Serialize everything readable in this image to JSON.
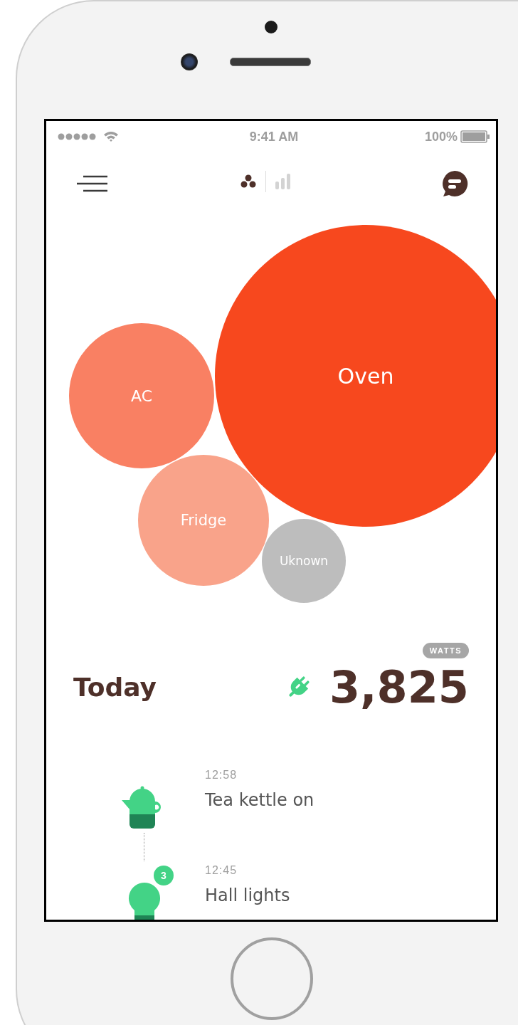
{
  "status_bar": {
    "time": "9:41 AM",
    "battery": "100%"
  },
  "view_toggles": [
    {
      "kind": "bubbles",
      "selected": true
    },
    {
      "kind": "bars",
      "selected": false
    }
  ],
  "bubbles": [
    {
      "label": "Oven",
      "color": "#f7481e"
    },
    {
      "label": "AC",
      "color": "#f98063"
    },
    {
      "label": "Fridge",
      "color": "#f9a38a"
    },
    {
      "label": "Uknown",
      "color": "#bdbdbd"
    }
  ],
  "summary": {
    "title": "Today",
    "unit": "WATTS",
    "value": "3,825"
  },
  "timeline": [
    {
      "kind": "kettle",
      "time": "12:58",
      "title": "Tea kettle on"
    },
    {
      "kind": "bulb",
      "time": "12:45",
      "title": "Hall lights",
      "badge": "3"
    }
  ]
}
